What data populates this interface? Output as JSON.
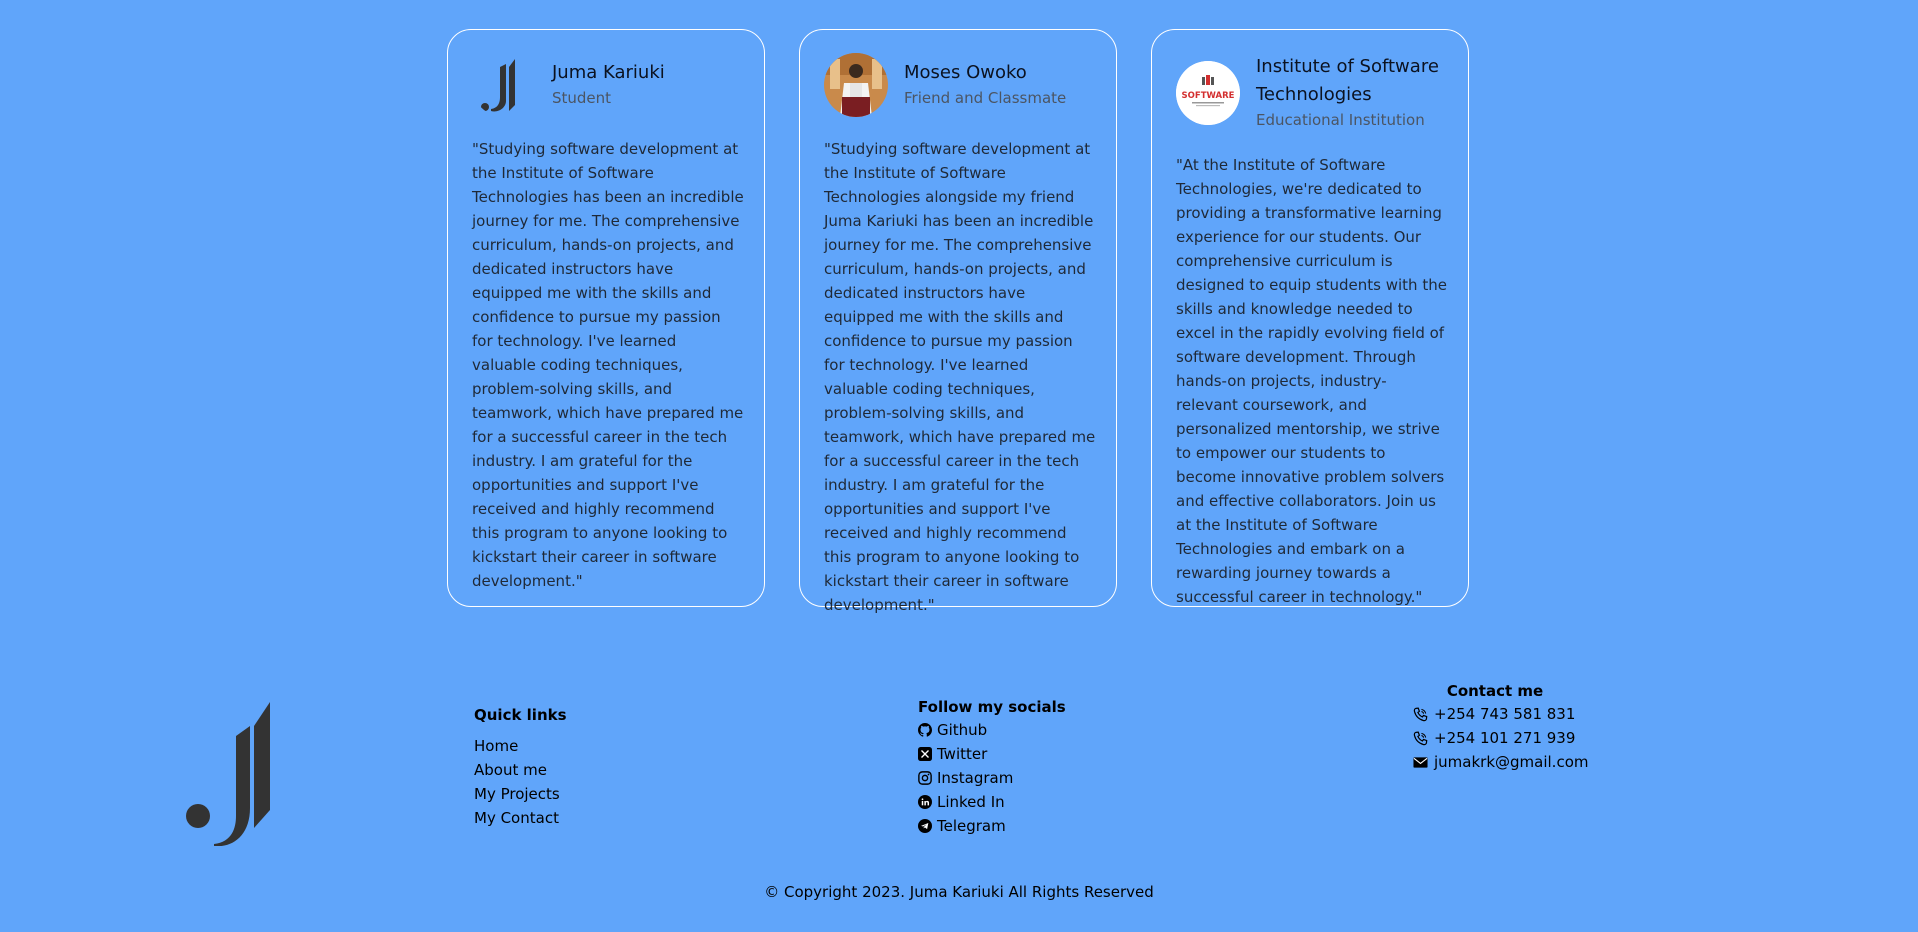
{
  "testimonials": [
    {
      "name": "Juma Kariuki",
      "role": "Student",
      "avatar_icon": "jk-logo",
      "quote": "\"Studying software development at the Institute of Software Technologies has been an incredible journey for me. The comprehensive curriculum, hands-on projects, and dedicated instructors have equipped me with the skills and confidence to pursue my passion for technology. I've learned valuable coding techniques, problem-solving skills, and teamwork, which have prepared me for a successful career in the tech industry. I am grateful for the opportunities and support I've received and highly recommend this program to anyone looking to kickstart their career in software development.\""
    },
    {
      "name": "Moses Owoko",
      "role": "Friend and Classmate",
      "avatar_icon": "profile-photo",
      "quote": "\"Studying software development at the Institute of Software Technologies alongside my friend Juma Kariuki has been an incredible journey for me. The comprehensive curriculum, hands-on projects, and dedicated instructors have equipped me with the skills and confidence to pursue my passion for technology. I've learned valuable coding techniques, problem-solving skills, and teamwork, which have prepared me for a successful career in the tech industry. I am grateful for the opportunities and support I've received and highly recommend this program to anyone looking to kickstart their career in software development.\""
    },
    {
      "name": "Institute of Software Technologies",
      "role": "Educational Institution",
      "avatar_icon": "institute-logo",
      "quote": "\"At the Institute of Software Technologies, we're dedicated to providing a transformative learning experience for our students. Our comprehensive curriculum is designed to equip students with the skills and knowledge needed to excel in the rapidly evolving field of software development. Through hands-on projects, industry-relevant coursework, and personalized mentorship, we strive to empower our students to become innovative problem solvers and effective collaborators. Join us at the Institute of Software Technologies and embark on a rewarding journey towards a successful career in technology.\""
    }
  ],
  "footer": {
    "logo_icon": "jk-logo",
    "quick_links": {
      "title": "Quick links",
      "items": [
        "Home",
        "About me",
        "My Projects",
        "My Contact"
      ]
    },
    "socials": {
      "title": "Follow my socials",
      "items": [
        {
          "label": "Github",
          "icon": "github-icon"
        },
        {
          "label": "Twitter",
          "icon": "x-twitter-icon"
        },
        {
          "label": "Instagram",
          "icon": "instagram-icon"
        },
        {
          "label": "Linked In",
          "icon": "linkedin-icon"
        },
        {
          "label": "Telegram",
          "icon": "telegram-icon"
        }
      ]
    },
    "contact": {
      "title": "Contact me",
      "phones": [
        "+254 743 581 831",
        "+254 101 271 939"
      ],
      "email": "jumakrk@gmail.com"
    },
    "copyright": "© Copyright 2023. Juma Kariuki All Rights Reserved"
  },
  "colors": {
    "background": "#60a5fa",
    "card_border": "#ffffff",
    "logo": "#333333"
  }
}
